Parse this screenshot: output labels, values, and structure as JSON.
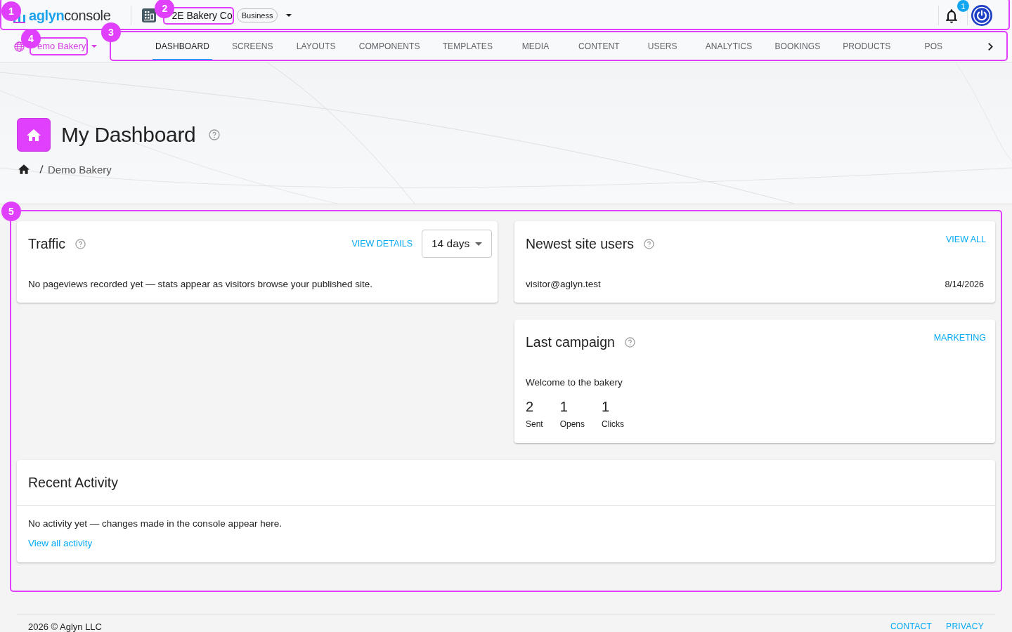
{
  "top_bar": {
    "marker": "1",
    "logo": {
      "brand": "aglyn",
      "product": "console"
    },
    "organization": {
      "marker": "2",
      "name": "2E Bakery Co",
      "plan": "Business"
    },
    "notifications": {
      "count": "1"
    }
  },
  "site_bar": {
    "marker": "4",
    "site_name": "emo Bakery"
  },
  "tabs": {
    "marker": "3",
    "items": [
      {
        "label": "DASHBOARD",
        "selected": true
      },
      {
        "label": "SCREENS",
        "selected": false
      },
      {
        "label": "LAYOUTS",
        "selected": false
      },
      {
        "label": "COMPONENTS",
        "selected": false
      },
      {
        "label": "TEMPLATES",
        "selected": false
      },
      {
        "label": "MEDIA",
        "selected": false
      },
      {
        "label": "CONTENT",
        "selected": false
      },
      {
        "label": "USERS",
        "selected": false
      },
      {
        "label": "ANALYTICS",
        "selected": false
      },
      {
        "label": "BOOKINGS",
        "selected": false
      },
      {
        "label": "PRODUCTS",
        "selected": false
      },
      {
        "label": "POS",
        "selected": false
      }
    ]
  },
  "page_header": {
    "title": "My Dashboard",
    "breadcrumb": [
      "Demo Bakery"
    ]
  },
  "dashboard": {
    "marker": "5",
    "traffic": {
      "title": "Traffic",
      "link": "VIEW DETAILS",
      "range": "14 days",
      "message": "No pageviews recorded yet — stats appear as visitors browse your published site."
    },
    "newest_users": {
      "title": "Newest site users",
      "link": "VIEW ALL",
      "users": [
        {
          "email": "visitor@aglyn.test",
          "date": "8/14/2026"
        }
      ]
    },
    "last_campaign": {
      "title": "Last campaign",
      "link": "MARKETING",
      "name": "Welcome to the bakery",
      "stats": [
        {
          "value": "2",
          "label": "Sent"
        },
        {
          "value": "1",
          "label": "Opens"
        },
        {
          "value": "1",
          "label": "Clicks"
        }
      ]
    },
    "recent_activity": {
      "title": "Recent Activity",
      "message": "No activity yet — changes made in the console appear here.",
      "link": "View all activity"
    }
  },
  "footer": {
    "copyright": "2026 © Aglyn LLC",
    "links": [
      "CONTACT",
      "PRIVACY"
    ]
  }
}
